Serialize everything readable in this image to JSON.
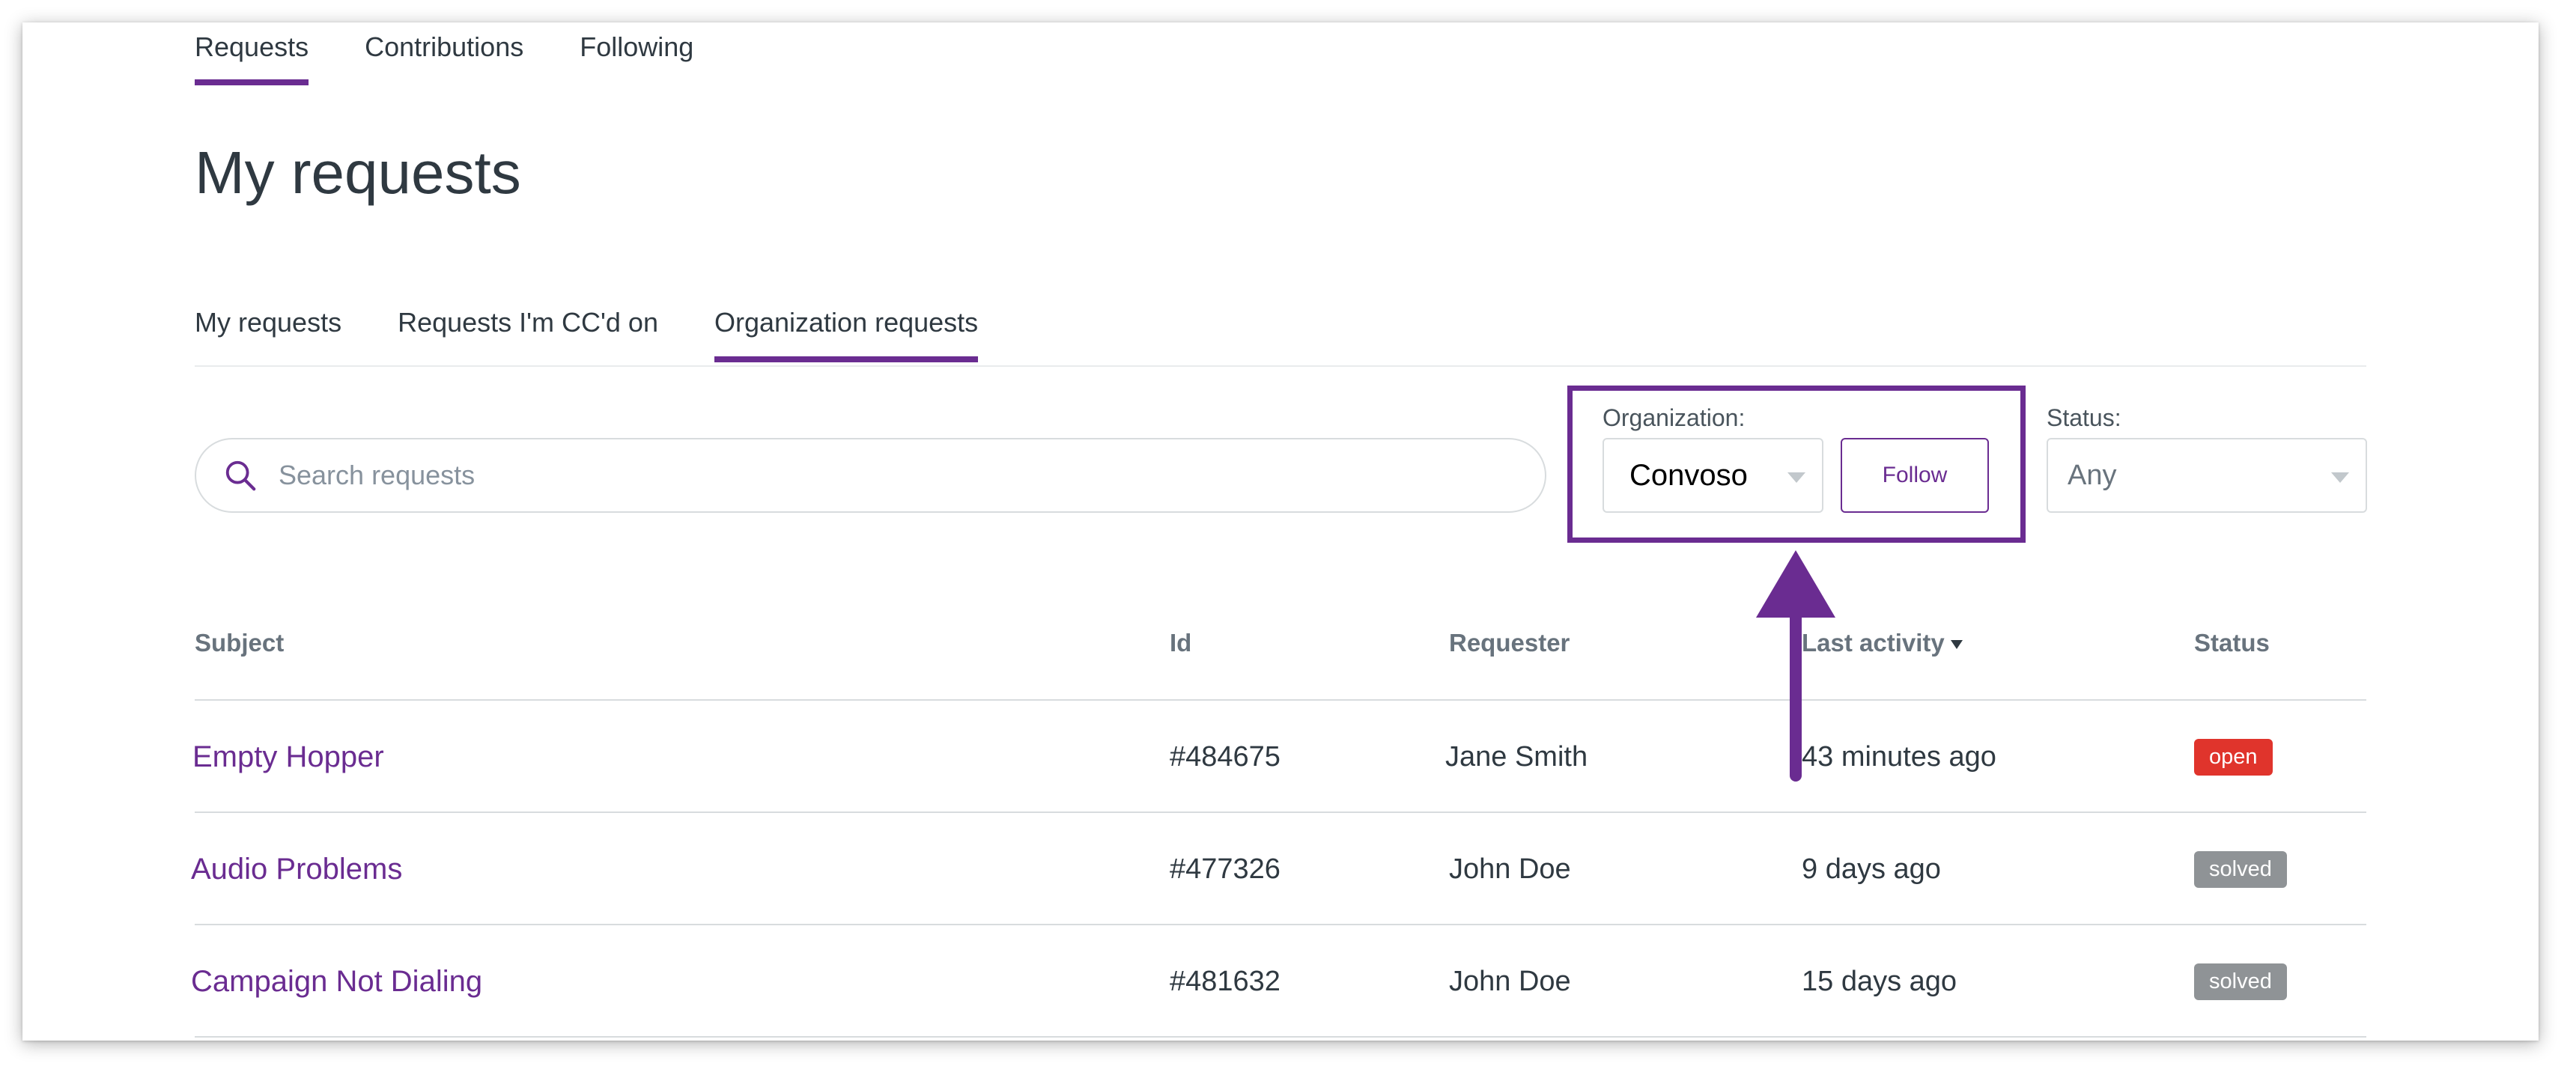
{
  "top_tabs": [
    {
      "label": "Requests",
      "active": true
    },
    {
      "label": "Contributions",
      "active": false
    },
    {
      "label": "Following",
      "active": false
    }
  ],
  "page_title": "My requests",
  "sub_tabs": [
    {
      "label": "My requests",
      "active": false
    },
    {
      "label": "Requests I'm CC'd on",
      "active": false
    },
    {
      "label": "Organization requests",
      "active": true
    }
  ],
  "search": {
    "placeholder": "Search requests",
    "value": ""
  },
  "filters": {
    "organization_label": "Organization:",
    "organization_value": "Convoso",
    "follow_label": "Follow",
    "status_label": "Status:",
    "status_value": "Any"
  },
  "table": {
    "columns": {
      "subject": "Subject",
      "id": "Id",
      "requester": "Requester",
      "last_activity": "Last activity",
      "status": "Status"
    },
    "rows": [
      {
        "subject": "Empty Hopper",
        "id": "#484675",
        "requester": "Jane Smith",
        "last_activity": "43 minutes ago",
        "status": "open"
      },
      {
        "subject": "Audio Problems",
        "id": "#477326",
        "requester": "John Doe",
        "last_activity": "9 days ago",
        "status": "solved"
      },
      {
        "subject": "Campaign Not Dialing",
        "id": "#481632",
        "requester": "John Doe",
        "last_activity": "15 days ago",
        "status": "solved"
      }
    ]
  },
  "colors": {
    "accent": "#6a2c91",
    "status_open": "#e0342c",
    "status_solved": "#8f9396"
  },
  "annotation": {
    "type": "arrow-and-highlight-box",
    "color": "#6a2c91",
    "target": "organization-filter"
  }
}
